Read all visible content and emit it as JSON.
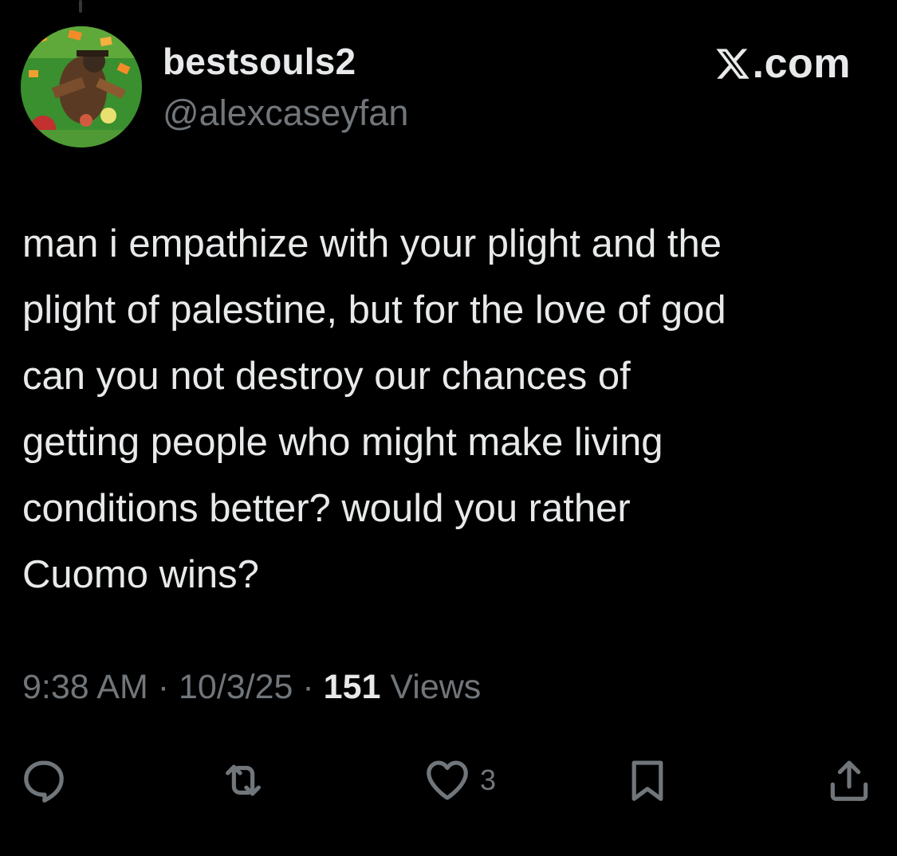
{
  "tweet": {
    "display_name": "bestsouls2",
    "handle": "@alexcaseyfan",
    "brand": "X.com",
    "text": "man i empathize with your plight and the\nplight of palestine, but for the love of god\ncan you not destroy our chances of\ngetting people who might make living\nconditions better? would you rather\nCuomo wins?",
    "time": "9:38 AM",
    "separator": " · ",
    "date": "10/3/25",
    "views_count": "151",
    "views_label": " Views"
  },
  "actions": {
    "reply": {
      "icon": "reply-icon"
    },
    "retweet": {
      "icon": "retweet-icon"
    },
    "like": {
      "icon": "heart-icon",
      "count": "3"
    },
    "bookmark": {
      "icon": "bookmark-icon"
    },
    "share": {
      "icon": "share-icon"
    }
  },
  "colors": {
    "background": "#000000",
    "primary_text": "#e7e9ea",
    "secondary_text": "#71767b"
  }
}
